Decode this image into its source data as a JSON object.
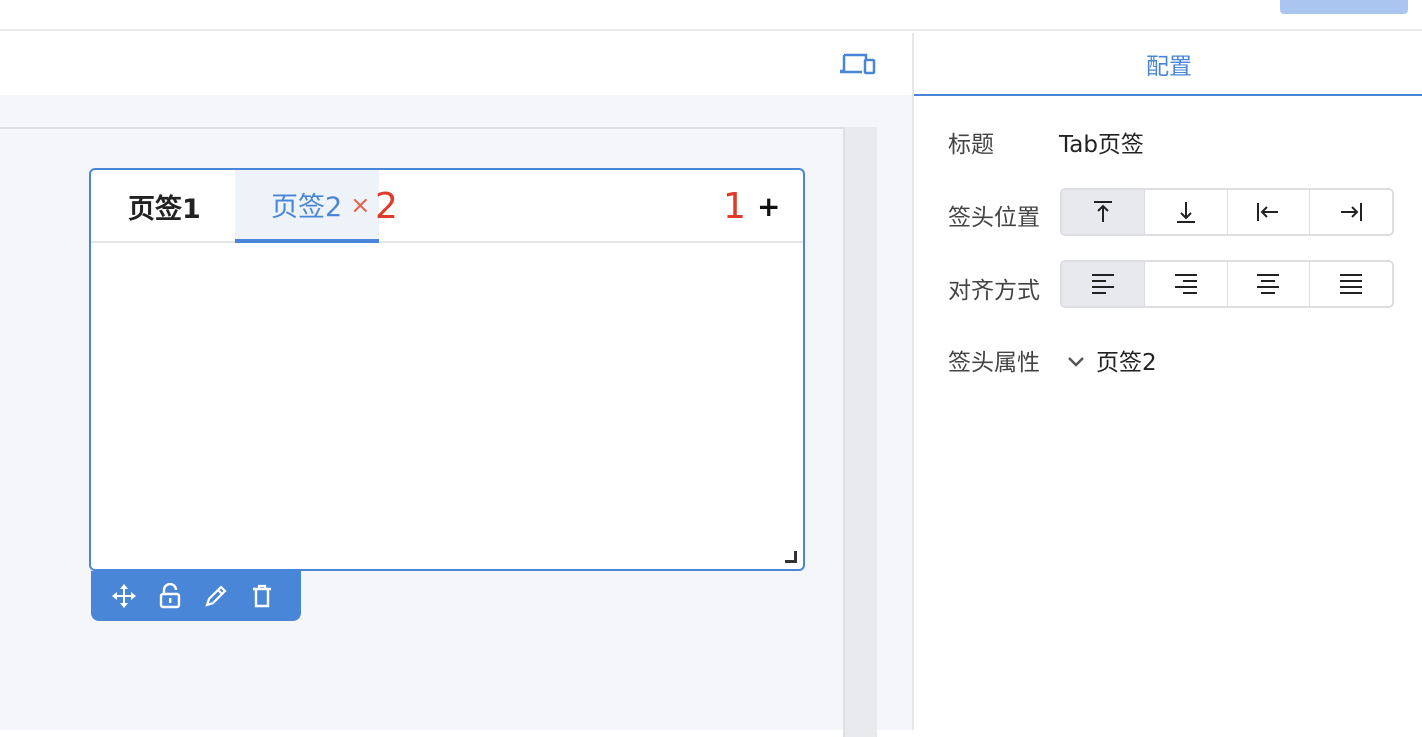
{
  "right_panel": {
    "tab_label": "配置",
    "title_label": "标题",
    "title_value": "Tab页签",
    "position_label": "签头位置",
    "position_options": [
      "top-align-icon",
      "bottom-align-icon",
      "left-align-icon",
      "right-align-icon"
    ],
    "align_label": "对齐方式",
    "align_options": [
      "align-left-icon",
      "align-right-icon",
      "align-center-icon",
      "align-justify-icon"
    ],
    "attr_label": "签头属性",
    "attr_value": "页签2"
  },
  "tabs_widget": {
    "tabs": [
      {
        "label": "页签1"
      },
      {
        "label": "页签2"
      }
    ],
    "close_symbol": "×",
    "add_symbol": "+",
    "annotations": [
      "2",
      "1"
    ]
  },
  "toolbar_icons": [
    "move-icon",
    "lock-icon",
    "edit-icon",
    "delete-icon"
  ],
  "colors": {
    "accent": "#4a86d8",
    "annotation": "#e03a2b",
    "canvas_bg": "#f5f6fa"
  }
}
